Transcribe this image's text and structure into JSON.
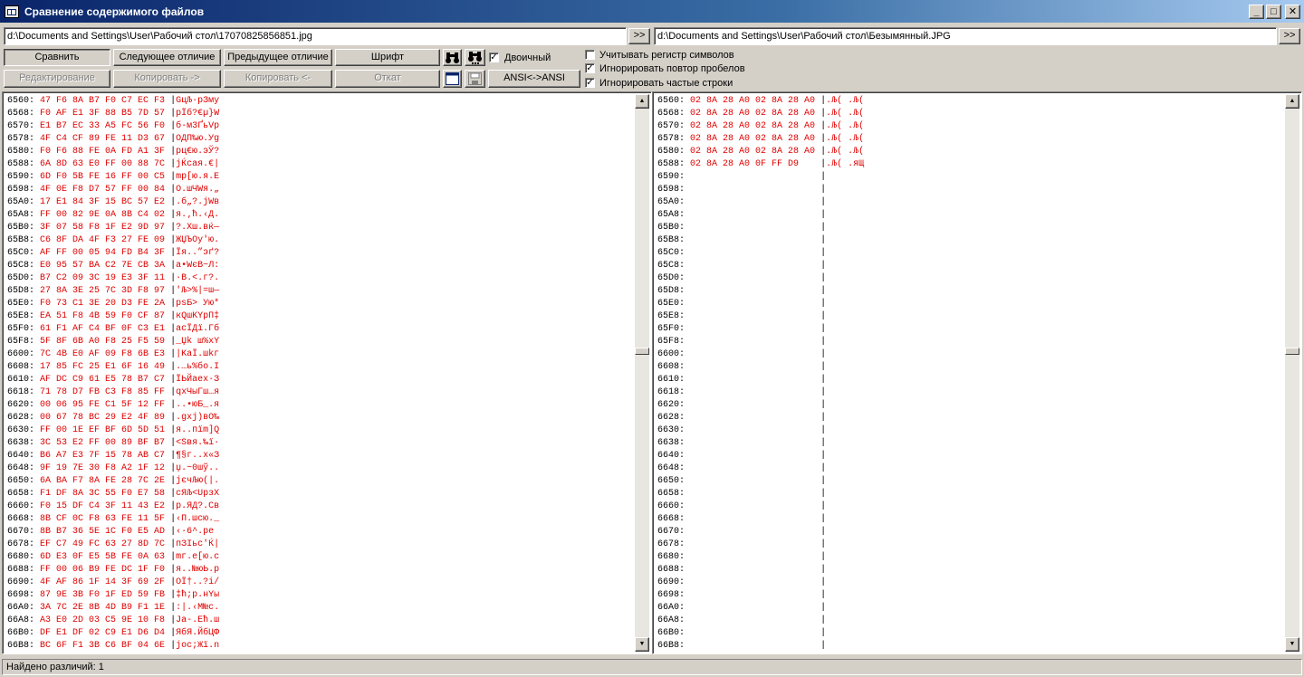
{
  "window": {
    "title": "Сравнение содержимого файлов",
    "minimize": "_",
    "maximize": "□",
    "close": "✕"
  },
  "paths": {
    "left": "d:\\Documents and Settings\\User\\Рабочий стол\\17070825856851.jpg",
    "right": "d:\\Documents and Settings\\User\\Рабочий стол\\Безымянный.JPG",
    "browse": ">>"
  },
  "toolbar": {
    "compare": "Сравнить",
    "next_diff": "Следующее отличие",
    "prev_diff": "Предыдущее отличие",
    "font": "Шрифт",
    "edit": "Редактирование",
    "copy_right": "Копировать ->",
    "copy_left": "Копировать <-",
    "rollback": "Откат",
    "binary_label": "Двоичный",
    "encoding": "ANSI<->ANSI"
  },
  "options": {
    "case_sensitive": "Учитывать регистр символов",
    "ignore_spaces": "Игнорировать повтор пробелов",
    "ignore_frequent": "Игнорировать частые строки"
  },
  "left_lines": [
    {
      "a": "6560:",
      "h": "47 F6 8A B7 F0 C7 EC F3",
      "t": "GцЉ·рЗму"
    },
    {
      "a": "6568:",
      "h": "F0 AF E1 3F 88 B5 7D 57",
      "t": "рЇб?€µ}W"
    },
    {
      "a": "6570:",
      "h": "E1 B7 EC 33 A5 FC 56 F0",
      "t": "б·м3ҐьVр"
    },
    {
      "a": "6578:",
      "h": "4F C4 CF 89 FE 11 D3 67",
      "t": "ОДП‰ю.Уg"
    },
    {
      "a": "6580:",
      "h": "F0 F6 88 FE 0A FD A1 3F",
      "t": "рц€ю.эЎ?"
    },
    {
      "a": "6588:",
      "h": "6A 8D 63 E0 FF 00 88 7C",
      "t": "jЌcая.€|"
    },
    {
      "a": "6590:",
      "h": "6D F0 5B FE 16 FF 00 C5",
      "t": "mр[ю.я.Е"
    },
    {
      "a": "6598:",
      "h": "4F 0E F8 D7 57 FF 00 84",
      "t": "O.шЧWя.„"
    },
    {
      "a": "65A0:",
      "h": "17 E1 84 3F 15 BC 57 E2",
      "t": ".б„?.јWв"
    },
    {
      "a": "65A8:",
      "h": "FF 00 82 9E 0A 8B C4 02",
      "t": "я.‚ћ.‹Д."
    },
    {
      "a": "65B0:",
      "h": "3F 07 58 F8 1F E2 9D 97",
      "t": "?.Xш.вќ—"
    },
    {
      "a": "65B8:",
      "h": "C6 8F DA 4F F3 27 FE 09",
      "t": "ЖЏЪOу'ю."
    },
    {
      "a": "65C0:",
      "h": "AF FF 00 05 94 FD B4 3F",
      "t": "Їя..”эґ?"
    },
    {
      "a": "65C8:",
      "h": "E0 95 57 BA C2 7E CB 3A",
      "t": "а•WєВ~Л:"
    },
    {
      "a": "65D0:",
      "h": "B7 C2 09 3C 19 E3 3F 11",
      "t": "·В.<.г?."
    },
    {
      "a": "65D8:",
      "h": "27 8A 3E 25 7C 3D F8 97",
      "t": "'Љ>%|=ш—"
    },
    {
      "a": "65E0:",
      "h": "F0 73 C1 3E 20 D3 FE 2A",
      "t": "psБ> Ую*"
    },
    {
      "a": "65E8:",
      "h": "EA 51 F8 4B 59 F0 CF 87",
      "t": "кQшKYрП‡"
    },
    {
      "a": "65F0:",
      "h": "61 F1 AF C4 BF 0F C3 E1",
      "t": "aсЇДї.Гб"
    },
    {
      "a": "65F8:",
      "h": "5F 8F 6B A0 F8 25 F5 59",
      "t": "_Џk ш%хY"
    },
    {
      "a": "6600:",
      "h": "7C 4B E0 AF 09 F8 6B E3",
      "t": "|KаЇ.шkг"
    },
    {
      "a": "6608:",
      "h": "17 85 FC 25 E1 6F 16 49",
      "t": ".…ь%бo.I"
    },
    {
      "a": "6610:",
      "h": "AF DC C9 61 E5 78 B7 C7",
      "t": "ЇЬЙaех·З"
    },
    {
      "a": "6618:",
      "h": "71 78 D7 FB C3 F8 85 FF",
      "t": "qхЧыГш…я"
    },
    {
      "a": "6620:",
      "h": "00 06 95 FE C1 5F 12 FF",
      "t": "..•юБ_.я"
    },
    {
      "a": "6628:",
      "h": "00 67 78 BC 29 E2 4F 89",
      "t": ".gxј)вO‰"
    },
    {
      "a": "6630:",
      "h": "FF 00 1E EF BF 6D 5D 51",
      "t": "я..пїm]Q"
    },
    {
      "a": "6638:",
      "h": "3C 53 E2 FF 00 89 BF B7",
      "t": "<Sвя.‰ї·"
    },
    {
      "a": "6640:",
      "h": "B6 A7 E3 7F 15 78 AB C7",
      "t": "¶§г..x«З"
    },
    {
      "a": "6648:",
      "h": "9F 19 7E 30 F8 A2 1F 12",
      "t": "џ.~0шў.."
    },
    {
      "a": "6650:",
      "h": "6A BA F7 8A FE 28 7C 2E",
      "t": "jєчЉю(|."
    },
    {
      "a": "6658:",
      "h": "F1 DF 8A 3C 55 F0 E7 58",
      "t": "сЯЉ<UрзX"
    },
    {
      "a": "6660:",
      "h": "F0 15 DF C4 3F 11 43 E2",
      "t": "р.ЯД?.Св"
    },
    {
      "a": "6668:",
      "h": "8B CF 0C F8 63 FE 11 5F",
      "t": "‹П.шcю._"
    },
    {
      "a": "6670:",
      "h": "8B B7 36 5E 1C F0 E5 AD",
      "t": "‹·6^.ре­"
    },
    {
      "a": "6678:",
      "h": "EF C7 49 FC 63 27 8D 7C",
      "t": "пЗIьc'Ќ|"
    },
    {
      "a": "6680:",
      "h": "6D E3 0F E5 5B FE 0A 63",
      "t": "mг.е[ю.c"
    },
    {
      "a": "6688:",
      "h": "FF 00 06 B9 FE DC 1F F0",
      "t": "я..№юЬ.р"
    },
    {
      "a": "6690:",
      "h": "4F AF 86 1F 14 3F 69 2F",
      "t": "OЇ†..?i/"
    },
    {
      "a": "6698:",
      "h": "87 9E 3B F0 1F ED 59 FB",
      "t": "‡ћ;р.нYы"
    },
    {
      "a": "66A0:",
      "h": "3A 7C 2E 8B 4D B9 F1 1E",
      "t": ":|.‹M№с."
    },
    {
      "a": "66A8:",
      "h": "A3 E0 2D 03 C5 9E 10 F8",
      "t": "Јa-.Ећ.ш"
    },
    {
      "a": "66B0:",
      "h": "DF E1 DF 02 C9 E1 D6 D4",
      "t": "ЯбЯ.ЙбЦФ"
    },
    {
      "a": "66B8:",
      "h": "BC 6F F1 3B C6 BF 04 6E",
      "t": "јoс;Жї.n"
    }
  ],
  "right_lines": [
    {
      "a": "6560:",
      "h": "02 8A 28 A0 02 8A 28 A0",
      "t": ".Љ( .Љ( "
    },
    {
      "a": "6568:",
      "h": "02 8A 28 A0 02 8A 28 A0",
      "t": ".Љ( .Љ( "
    },
    {
      "a": "6570:",
      "h": "02 8A 28 A0 02 8A 28 A0",
      "t": ".Љ( .Љ( "
    },
    {
      "a": "6578:",
      "h": "02 8A 28 A0 02 8A 28 A0",
      "t": ".Љ( .Љ( "
    },
    {
      "a": "6580:",
      "h": "02 8A 28 A0 02 8A 28 A0",
      "t": ".Љ( .Љ( "
    },
    {
      "a": "6588:",
      "h": "02 8A 28 A0 0F FF D9   ",
      "t": ".Љ( .яЩ"
    },
    {
      "a": "6590:",
      "h": "",
      "t": ""
    },
    {
      "a": "6598:",
      "h": "",
      "t": ""
    },
    {
      "a": "65A0:",
      "h": "",
      "t": ""
    },
    {
      "a": "65A8:",
      "h": "",
      "t": ""
    },
    {
      "a": "65B0:",
      "h": "",
      "t": ""
    },
    {
      "a": "65B8:",
      "h": "",
      "t": ""
    },
    {
      "a": "65C0:",
      "h": "",
      "t": ""
    },
    {
      "a": "65C8:",
      "h": "",
      "t": ""
    },
    {
      "a": "65D0:",
      "h": "",
      "t": ""
    },
    {
      "a": "65D8:",
      "h": "",
      "t": ""
    },
    {
      "a": "65E0:",
      "h": "",
      "t": ""
    },
    {
      "a": "65E8:",
      "h": "",
      "t": ""
    },
    {
      "a": "65F0:",
      "h": "",
      "t": ""
    },
    {
      "a": "65F8:",
      "h": "",
      "t": ""
    },
    {
      "a": "6600:",
      "h": "",
      "t": ""
    },
    {
      "a": "6608:",
      "h": "",
      "t": ""
    },
    {
      "a": "6610:",
      "h": "",
      "t": ""
    },
    {
      "a": "6618:",
      "h": "",
      "t": ""
    },
    {
      "a": "6620:",
      "h": "",
      "t": ""
    },
    {
      "a": "6628:",
      "h": "",
      "t": ""
    },
    {
      "a": "6630:",
      "h": "",
      "t": ""
    },
    {
      "a": "6638:",
      "h": "",
      "t": ""
    },
    {
      "a": "6640:",
      "h": "",
      "t": ""
    },
    {
      "a": "6648:",
      "h": "",
      "t": ""
    },
    {
      "a": "6650:",
      "h": "",
      "t": ""
    },
    {
      "a": "6658:",
      "h": "",
      "t": ""
    },
    {
      "a": "6660:",
      "h": "",
      "t": ""
    },
    {
      "a": "6668:",
      "h": "",
      "t": ""
    },
    {
      "a": "6670:",
      "h": "",
      "t": ""
    },
    {
      "a": "6678:",
      "h": "",
      "t": ""
    },
    {
      "a": "6680:",
      "h": "",
      "t": ""
    },
    {
      "a": "6688:",
      "h": "",
      "t": ""
    },
    {
      "a": "6690:",
      "h": "",
      "t": ""
    },
    {
      "a": "6698:",
      "h": "",
      "t": ""
    },
    {
      "a": "66A0:",
      "h": "",
      "t": ""
    },
    {
      "a": "66A8:",
      "h": "",
      "t": ""
    },
    {
      "a": "66B0:",
      "h": "",
      "t": ""
    },
    {
      "a": "66B8:",
      "h": "",
      "t": ""
    }
  ],
  "status": {
    "text": "Найдено различий: 1"
  },
  "icons": {
    "find": "binoculars-icon",
    "find_next": "binoculars-next-icon",
    "view": "window-icon",
    "save": "save-icon"
  }
}
